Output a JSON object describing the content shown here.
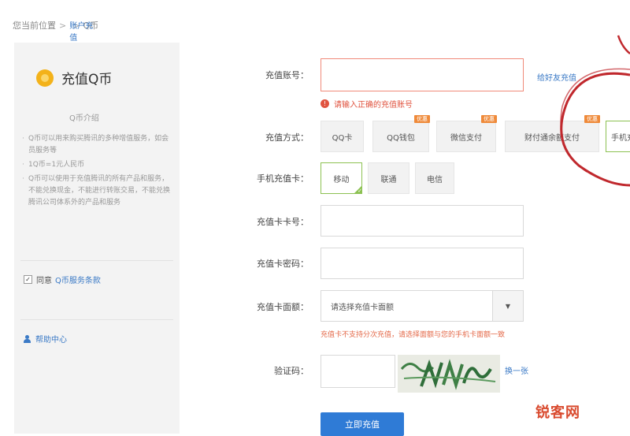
{
  "breadcrumb": {
    "items": [
      "您当前位置",
      "账户充值",
      "Q币"
    ]
  },
  "sidebar": {
    "title": "充值Q币",
    "subtitle": "Q币介绍",
    "desc": [
      "Q币可以用来购买腾讯的多种增值服务，如会员服务等",
      "1Q币=1元人民币",
      "Q币可以使用于充值腾讯的所有产品和服务，不能兑换现金，不能进行转账交易，不能兑换腾讯公司体系外的产品和服务"
    ],
    "agree_label": "同意",
    "agree_link": "Q币服务条款",
    "help_label": "帮助中心"
  },
  "form": {
    "account": {
      "label": "充值账号：",
      "value": "",
      "link": "给好友充值",
      "error": "请输入正确的充值账号"
    },
    "method": {
      "label": "充值方式：",
      "options": [
        {
          "label": "QQ卡",
          "badge": ""
        },
        {
          "label": "QQ钱包",
          "badge": "优惠"
        },
        {
          "label": "微信支付",
          "badge": "优惠"
        },
        {
          "label": "财付通余额支付",
          "badge": "优惠"
        },
        {
          "label": "手机充值卡",
          "badge": ""
        }
      ]
    },
    "mobile_card": {
      "label": "手机充值卡：",
      "options": [
        "移动",
        "联通",
        "电信"
      ],
      "selected": "移动"
    },
    "card_number": {
      "label": "充值卡卡号：",
      "value": ""
    },
    "card_password": {
      "label": "充值卡密码：",
      "value": ""
    },
    "card_value": {
      "label": "充值卡面额：",
      "placeholder": "请选择充值卡面额",
      "hint": "充值卡不支持分次充值，请选择面额与您的手机卡面额一致"
    },
    "captcha": {
      "label": "验证码：",
      "value": "",
      "refresh": "换一张"
    },
    "submit_label": "立即充值"
  },
  "watermark": "锐客网",
  "colors": {
    "accent": "#2f7bd6",
    "error": "#e0533f",
    "selected_border": "#8cc152",
    "badge": "#ef8a3a",
    "annotation": "#c0282d"
  }
}
